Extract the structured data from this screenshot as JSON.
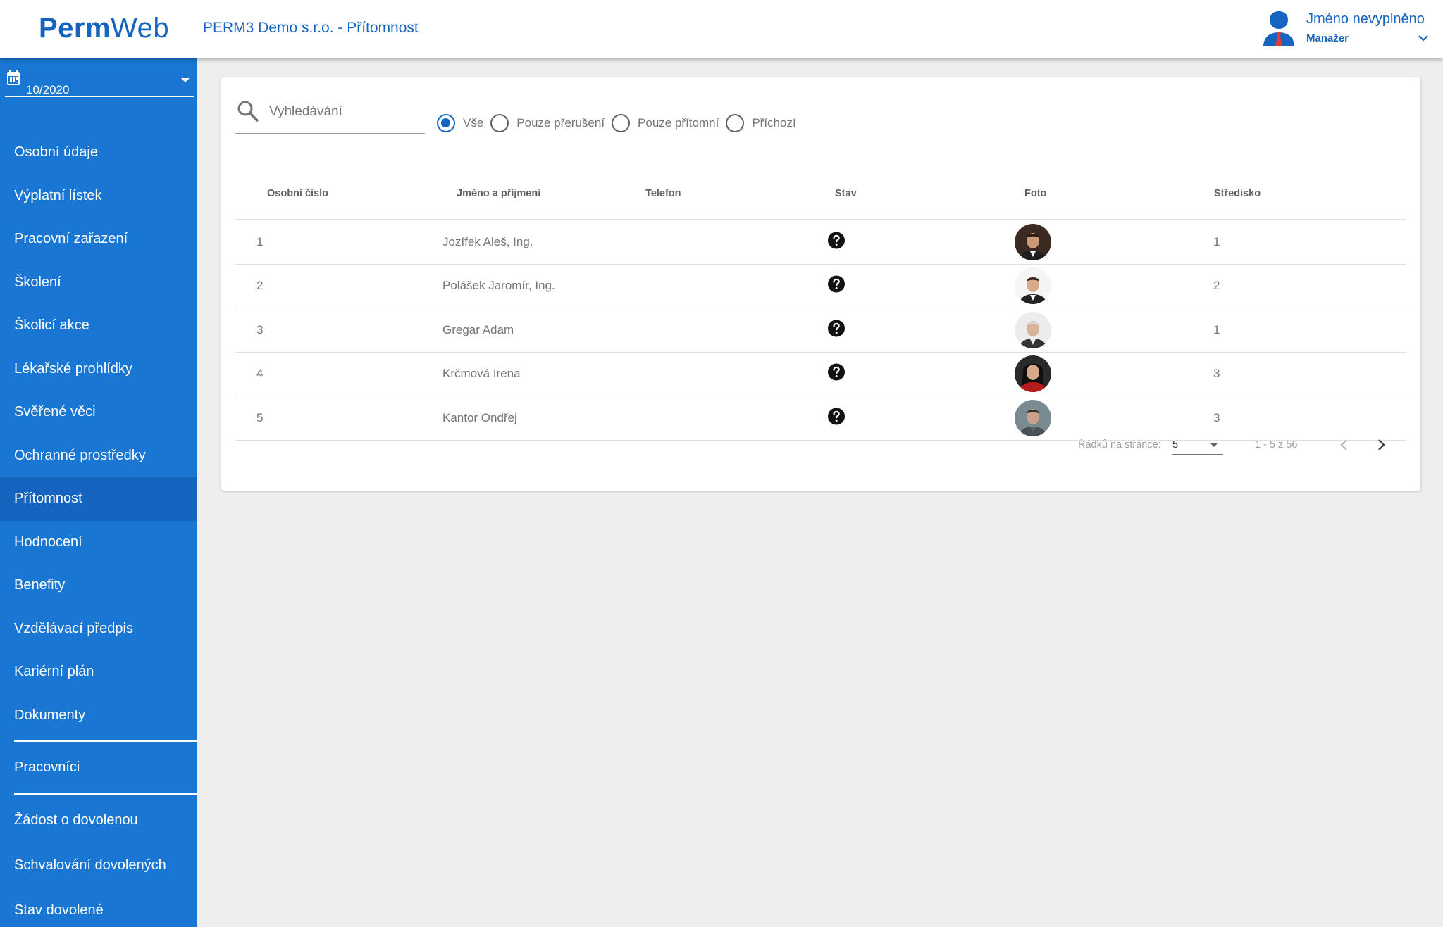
{
  "header": {
    "logo_bold": "Perm",
    "logo_light": "Web",
    "title": "PERM3 Demo s.r.o. - Přítomnost",
    "user_name": "Jméno nevyplněno",
    "user_role": "Manažer"
  },
  "sidebar": {
    "date_value": "10/2020",
    "items": [
      {
        "label": "Osobní údaje"
      },
      {
        "label": "Výplatní lístek"
      },
      {
        "label": "Pracovní zařazení"
      },
      {
        "label": "Školení"
      },
      {
        "label": "Školicí akce"
      },
      {
        "label": "Lékařské prohlídky"
      },
      {
        "label": "Svěřené věci"
      },
      {
        "label": "Ochranné prostředky"
      },
      {
        "label": "Přítomnost",
        "active": true
      },
      {
        "label": "Hodnocení"
      },
      {
        "label": "Benefity"
      },
      {
        "label": "Vzdělávací předpis"
      },
      {
        "label": "Kariérní plán"
      },
      {
        "label": "Dokumenty"
      }
    ],
    "section2": [
      {
        "label": "Pracovníci"
      }
    ],
    "section3": [
      {
        "label": "Žádost o dovolenou"
      },
      {
        "label": "Schvalování dovolených"
      },
      {
        "label": "Stav dovolené"
      }
    ]
  },
  "search": {
    "placeholder": "Vyhledávání",
    "value": ""
  },
  "filters": [
    {
      "label": "Vše",
      "checked": true
    },
    {
      "label": "Pouze přerušení",
      "checked": false
    },
    {
      "label": "Pouze přítomní",
      "checked": false
    },
    {
      "label": "Příchozí",
      "checked": false
    }
  ],
  "table": {
    "columns": [
      "Osobní číslo",
      "Jméno a příjmení",
      "Telefon",
      "Stav",
      "Foto",
      "Středisko"
    ],
    "rows": [
      {
        "id": "1",
        "name": "Jozífek Aleš, Ing.",
        "phone": "",
        "status_icon": "help-icon",
        "photo": "avatar-man-1",
        "center": "1"
      },
      {
        "id": "2",
        "name": "Polášek Jaromír, Ing.",
        "phone": "",
        "status_icon": "help-icon",
        "photo": "avatar-man-2",
        "center": "2"
      },
      {
        "id": "3",
        "name": "Gregar Adam",
        "phone": "",
        "status_icon": "help-icon",
        "photo": "avatar-man-3",
        "center": "1"
      },
      {
        "id": "4",
        "name": "Krčmová Irena",
        "phone": "",
        "status_icon": "help-icon",
        "photo": "avatar-woman-1",
        "center": "3"
      },
      {
        "id": "5",
        "name": "Kantor Ondřej",
        "phone": "",
        "status_icon": "help-icon",
        "photo": "avatar-man-4",
        "center": "3"
      }
    ]
  },
  "pager": {
    "rows_label": "Řádků na stránce:",
    "rows_value": "5",
    "range": "1 - 5 z 56"
  },
  "colors": {
    "primary": "#1976d2",
    "primary_dark": "#1565c0",
    "background": "#eeeeee"
  }
}
